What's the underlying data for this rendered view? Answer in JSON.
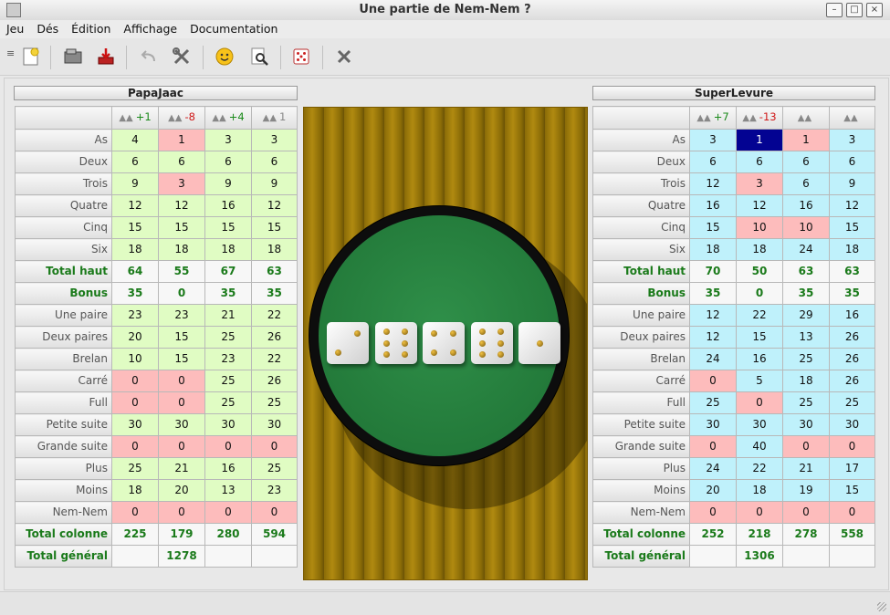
{
  "window": {
    "title": "Une partie de Nem-Nem ?"
  },
  "menu": [
    "Jeu",
    "Dés",
    "Édition",
    "Affichage",
    "Documentation"
  ],
  "toolbar": {
    "buttons": [
      "new-game-icon",
      "open-icon",
      "save-icon",
      "undo-icon",
      "tools-icon",
      "smiley-icon",
      "preview-icon",
      "dice-icon",
      "close-icon"
    ]
  },
  "rows": [
    "As",
    "Deux",
    "Trois",
    "Quatre",
    "Cinq",
    "Six",
    "Total haut",
    "Bonus",
    "Une paire",
    "Deux paires",
    "Brelan",
    "Carré",
    "Full",
    "Petite suite",
    "Grande suite",
    "Plus",
    "Moins",
    "Nem-Nem",
    "Total colonne",
    "Total général"
  ],
  "players": [
    {
      "name": "PapaJaac",
      "headers": [
        "+1",
        "-8",
        "+4",
        "1"
      ],
      "values": [
        [
          "4",
          "1",
          "3",
          "3"
        ],
        [
          "6",
          "6",
          "6",
          "6"
        ],
        [
          "9",
          "3",
          "9",
          "9"
        ],
        [
          "12",
          "12",
          "16",
          "12"
        ],
        [
          "15",
          "15",
          "15",
          "15"
        ],
        [
          "18",
          "18",
          "18",
          "18"
        ],
        [
          "64",
          "55",
          "67",
          "63"
        ],
        [
          "35",
          "0",
          "35",
          "35"
        ],
        [
          "23",
          "23",
          "21",
          "22"
        ],
        [
          "20",
          "15",
          "25",
          "26"
        ],
        [
          "10",
          "15",
          "23",
          "22"
        ],
        [
          "0",
          "0",
          "25",
          "26"
        ],
        [
          "0",
          "0",
          "25",
          "25"
        ],
        [
          "30",
          "30",
          "30",
          "30"
        ],
        [
          "0",
          "0",
          "0",
          "0"
        ],
        [
          "25",
          "21",
          "16",
          "25"
        ],
        [
          "18",
          "20",
          "13",
          "23"
        ],
        [
          "0",
          "0",
          "0",
          "0"
        ],
        [
          "225",
          "179",
          "280",
          "594"
        ]
      ],
      "grand_total": "1278"
    },
    {
      "name": "SuperLevure",
      "headers": [
        "+7",
        "-13",
        "",
        ""
      ],
      "values": [
        [
          "3",
          "1",
          "1",
          "3"
        ],
        [
          "6",
          "6",
          "6",
          "6"
        ],
        [
          "12",
          "3",
          "6",
          "9"
        ],
        [
          "16",
          "12",
          "16",
          "12"
        ],
        [
          "15",
          "10",
          "10",
          "15"
        ],
        [
          "18",
          "18",
          "24",
          "18"
        ],
        [
          "70",
          "50",
          "63",
          "63"
        ],
        [
          "35",
          "0",
          "35",
          "35"
        ],
        [
          "12",
          "22",
          "29",
          "16"
        ],
        [
          "12",
          "15",
          "13",
          "26"
        ],
        [
          "24",
          "16",
          "25",
          "26"
        ],
        [
          "0",
          "5",
          "18",
          "26"
        ],
        [
          "25",
          "0",
          "25",
          "25"
        ],
        [
          "30",
          "30",
          "30",
          "30"
        ],
        [
          "0",
          "40",
          "0",
          "0"
        ],
        [
          "24",
          "22",
          "21",
          "17"
        ],
        [
          "20",
          "18",
          "19",
          "15"
        ],
        [
          "0",
          "0",
          "0",
          "0"
        ],
        [
          "252",
          "218",
          "278",
          "558"
        ]
      ],
      "grand_total": "1306"
    }
  ],
  "dice": [
    2,
    6,
    4,
    6,
    1
  ],
  "colors": {
    "normal_left": "#e0fcc3",
    "normal_right": "#bff1fb",
    "zero": "#fdbcbc",
    "selected": "#030392",
    "total": "#1a7a1a"
  }
}
